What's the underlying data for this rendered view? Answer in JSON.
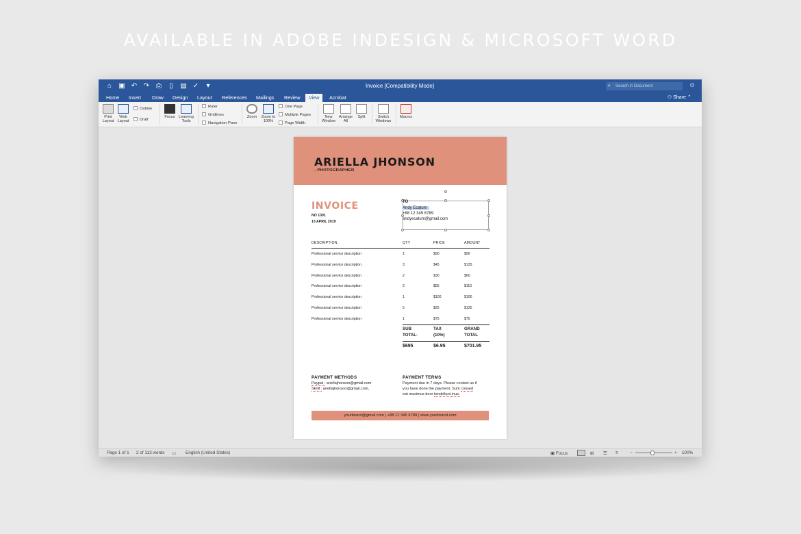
{
  "headline": "AVAILABLE IN ADOBE INDESIGN & MICROSOFT WORD",
  "window": {
    "title": "Invoice [Compatibility Mode]",
    "search_placeholder": "Search in Document",
    "share_label": "Share"
  },
  "tabs": [
    "Home",
    "Insert",
    "Draw",
    "Design",
    "Layout",
    "References",
    "Mailings",
    "Review",
    "View",
    "Acrobat"
  ],
  "active_tab": "View",
  "ribbon": {
    "print_layout": "Print Layout",
    "web_layout": "Web Layout",
    "outline": "Outline",
    "draft": "Draft",
    "focus": "Focus",
    "learning_tools": "Learning Tools",
    "ruler": "Ruler",
    "gridlines": "Gridlines",
    "navigation_pane": "Navigation Pane",
    "zoom": "Zoom",
    "zoom_100": "Zoom to 100%",
    "one_page": "One Page",
    "multiple_pages": "Multiple Pages",
    "page_width": "Page Width",
    "new_window": "New Window",
    "arrange_all": "Arrange All",
    "split": "Split",
    "switch_windows": "Switch Windows",
    "macros": "Macros"
  },
  "invoice": {
    "name": "ARIELLA JHONSON",
    "role": "- PHOTOGRAPHER",
    "title": "INVOICE",
    "number": "NO 1301",
    "date": "13 APRIL 2019",
    "to_label": "TO",
    "to_name": "Andy Ecatum",
    "to_phone": "+88 12 345 6789",
    "to_email": "andyecatum@gmail.com",
    "headers": {
      "description": "DESCRIPTION",
      "qty": "QTY",
      "price": "PRICE",
      "amount": "AMOUNT"
    },
    "rows": [
      {
        "description": "Professional service description",
        "qty": "1",
        "price": "$90",
        "amount": "$90"
      },
      {
        "description": "Professional service description",
        "qty": "3",
        "price": "$45",
        "amount": "$135"
      },
      {
        "description": "Professional service description",
        "qty": "2",
        "price": "$30",
        "amount": "$60"
      },
      {
        "description": "Professional service description",
        "qty": "2",
        "price": "$55",
        "amount": "$110"
      },
      {
        "description": "Professional service description",
        "qty": "1",
        "price": "$100",
        "amount": "$100"
      },
      {
        "description": "Professional service description",
        "qty": "5",
        "price": "$25",
        "amount": "$125"
      },
      {
        "description": "Professional service description",
        "qty": "1",
        "price": "$75",
        "amount": "$75"
      }
    ],
    "totals": {
      "sub_line1": "SUB",
      "sub_line2": "TOTAL",
      "sub_suffix": "*",
      "tax_line1": "TAX",
      "tax_line2": "(10%)",
      "grand_line1": "GRAND",
      "grand_line2": "TOTAL",
      "sub_value": "$695",
      "tax_value": "$6.95",
      "grand_value": "$701.95"
    },
    "payment_methods": {
      "title": "PAYMENT METHODS",
      "line1_label": "Paypal :",
      "line1_value": "ariellajhonson@gmail.com",
      "line2_label": "Skrill :",
      "line2_value": "ariellajhonson@gmail.com,"
    },
    "payment_terms": {
      "title": "PAYMENT TERMS",
      "line1": "Payment due in 7 days. Please contact us if",
      "line2_pre": "you have done the payment. Sum ",
      "line2_word": "consed",
      "line3_pre": "eat maximus dero ",
      "line3_word": "tendellant inus."
    },
    "footer": "yourbrand@gmail.com | +88 12 345 6789 | www.yourbrand.com"
  },
  "status": {
    "page": "Page 1 of 1",
    "words": "2 of 113 words",
    "language": "English (United States)",
    "focus": "Focus",
    "zoom": "100%"
  }
}
